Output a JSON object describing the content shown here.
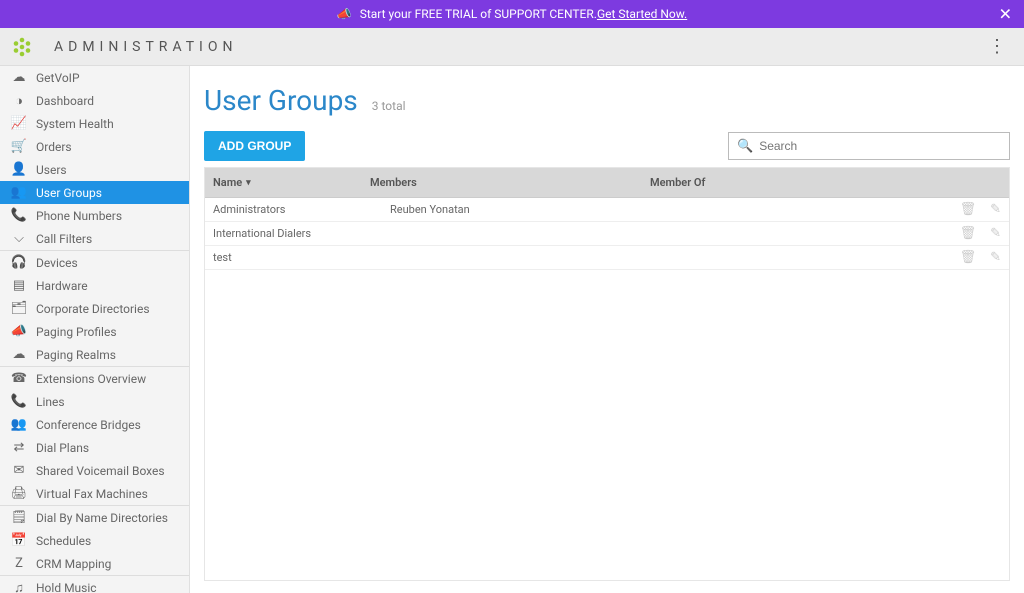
{
  "banner": {
    "text": "Start your FREE TRIAL of SUPPORT CENTER. ",
    "link_text": "Get Started Now.",
    "close": "✕"
  },
  "header": {
    "title": "ADMINISTRATION"
  },
  "sidebar": {
    "items": [
      {
        "icon": "cloud",
        "label": "GetVoIP"
      },
      {
        "icon": "gauge",
        "label": "Dashboard"
      },
      {
        "icon": "pulse",
        "label": "System Health"
      },
      {
        "icon": "cart",
        "label": "Orders"
      },
      {
        "icon": "user",
        "label": "Users"
      },
      {
        "icon": "group",
        "label": "User Groups",
        "active": true
      },
      {
        "icon": "phone",
        "label": "Phone Numbers"
      },
      {
        "icon": "funnel",
        "label": "Call Filters"
      },
      {
        "icon": "",
        "label": "",
        "divider": true
      },
      {
        "icon": "headset",
        "label": "Devices"
      },
      {
        "icon": "hw",
        "label": "Hardware"
      },
      {
        "icon": "dir",
        "label": "Corporate Directories"
      },
      {
        "icon": "bullpage",
        "label": "Paging Profiles"
      },
      {
        "icon": "cloud2",
        "label": "Paging Realms"
      },
      {
        "icon": "",
        "label": "",
        "divider": true
      },
      {
        "icon": "ext",
        "label": "Extensions Overview"
      },
      {
        "icon": "line",
        "label": "Lines"
      },
      {
        "icon": "conf",
        "label": "Conference Bridges"
      },
      {
        "icon": "dial",
        "label": "Dial Plans"
      },
      {
        "icon": "vm",
        "label": "Shared Voicemail Boxes"
      },
      {
        "icon": "fax",
        "label": "Virtual Fax Machines"
      },
      {
        "icon": "",
        "label": "",
        "divider": true
      },
      {
        "icon": "dbn",
        "label": "Dial By Name Directories"
      },
      {
        "icon": "cal",
        "label": "Schedules"
      },
      {
        "icon": "crm",
        "label": "CRM Mapping"
      },
      {
        "icon": "",
        "label": "",
        "divider": true
      },
      {
        "icon": "music",
        "label": "Hold Music"
      }
    ]
  },
  "main": {
    "title": "User Groups",
    "subtitle": "3 total",
    "add_label": "ADD GROUP",
    "search_placeholder": "Search",
    "columns": {
      "name": "Name",
      "members": "Members",
      "memberof": "Member Of"
    },
    "rows": [
      {
        "name": "Administrators",
        "members": "Reuben Yonatan",
        "memberof": ""
      },
      {
        "name": "International Dialers",
        "members": "",
        "memberof": ""
      },
      {
        "name": "test",
        "members": "",
        "memberof": ""
      }
    ]
  },
  "icons": {
    "cloud": "☁",
    "gauge": "◑",
    "pulse": "📈",
    "cart": "🛒",
    "user": "👤",
    "group": "👥",
    "phone": "📞",
    "funnel": "⌵",
    "headset": "🎧",
    "hw": "▤",
    "dir": "🗂",
    "bullpage": "📣",
    "cloud2": "☁",
    "ext": "☎",
    "line": "📞",
    "conf": "👥",
    "dial": "⇄",
    "vm": "✉",
    "fax": "🖨",
    "dbn": "🗒",
    "cal": "📅",
    "crm": "Z",
    "music": "♫",
    "bullhorn": "📣",
    "search": "🔍",
    "trash": "🗑",
    "pencil": "✎",
    "dots": "⋮"
  }
}
